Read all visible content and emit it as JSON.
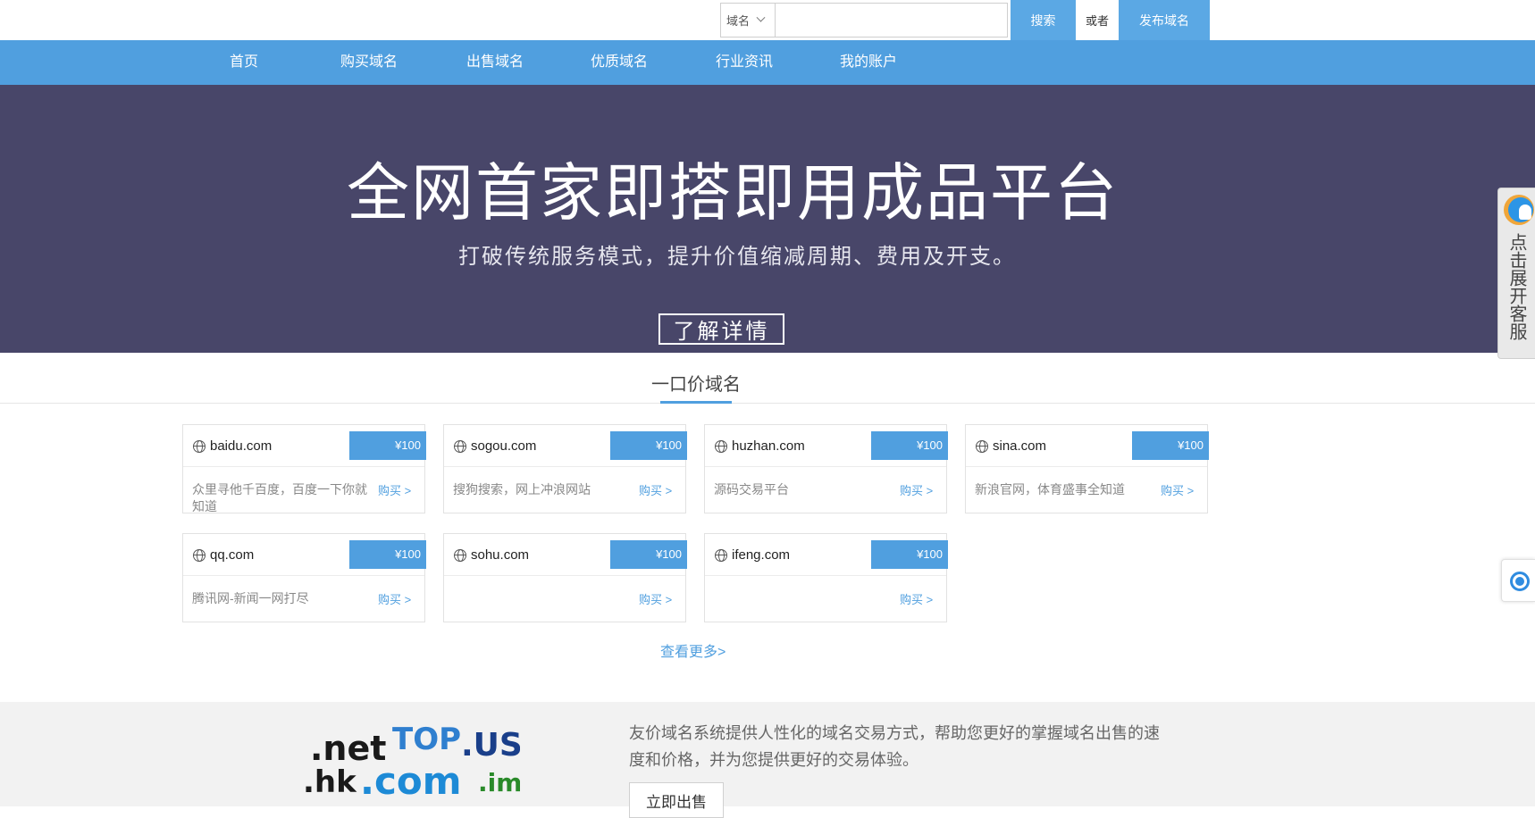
{
  "search": {
    "category_selected": "域名",
    "input_value": "",
    "search_label": "搜索",
    "or_label": "或者",
    "publish_label": "发布域名"
  },
  "nav": {
    "items": [
      {
        "label": "首页"
      },
      {
        "label": "购买域名"
      },
      {
        "label": "出售域名"
      },
      {
        "label": "优质域名"
      },
      {
        "label": "行业资讯"
      },
      {
        "label": "我的账户"
      }
    ]
  },
  "hero": {
    "title": "全网首家即搭即用成品平台",
    "subtitle": "打破传统服务模式，提升价值缩减周期、费用及开支。",
    "button": "了解详情"
  },
  "customer_service": {
    "tab_text": "点击展开客服"
  },
  "section": {
    "title": "一口价域名",
    "more_link": "查看更多>"
  },
  "domains": [
    {
      "domain": "baidu.com",
      "price": "¥100",
      "desc": "众里寻他千百度，百度一下你就知道",
      "buy": "购买 >"
    },
    {
      "domain": "sogou.com",
      "price": "¥100",
      "desc": "搜狗搜索，网上冲浪网站",
      "buy": "购买 >"
    },
    {
      "domain": "huzhan.com",
      "price": "¥100",
      "desc": "源码交易平台",
      "buy": "购买 >"
    },
    {
      "domain": "sina.com",
      "price": "¥100",
      "desc": "新浪官网，体育盛事全知道",
      "buy": "购买 >"
    },
    {
      "domain": "qq.com",
      "price": "¥100",
      "desc": "腾讯网-新闻一网打尽",
      "buy": "购买 >"
    },
    {
      "domain": "sohu.com",
      "price": "¥100",
      "desc": "",
      "buy": "购买 >"
    },
    {
      "domain": "ifeng.com",
      "price": "¥100",
      "desc": "",
      "buy": "购买 >"
    }
  ],
  "footer": {
    "logo_words": [
      ".net",
      "TOP",
      ".US",
      ".hk",
      ".com",
      ".im"
    ],
    "description": "友价域名系统提供人性化的域名交易方式，帮助您更好的掌握域名出售的速度和价格，并为您提供更好的交易体验。",
    "sell_button": "立即出售"
  },
  "colors": {
    "primary": "#509fdf",
    "hero_bg": "#484669",
    "footer_bg": "#f2f2f2"
  }
}
